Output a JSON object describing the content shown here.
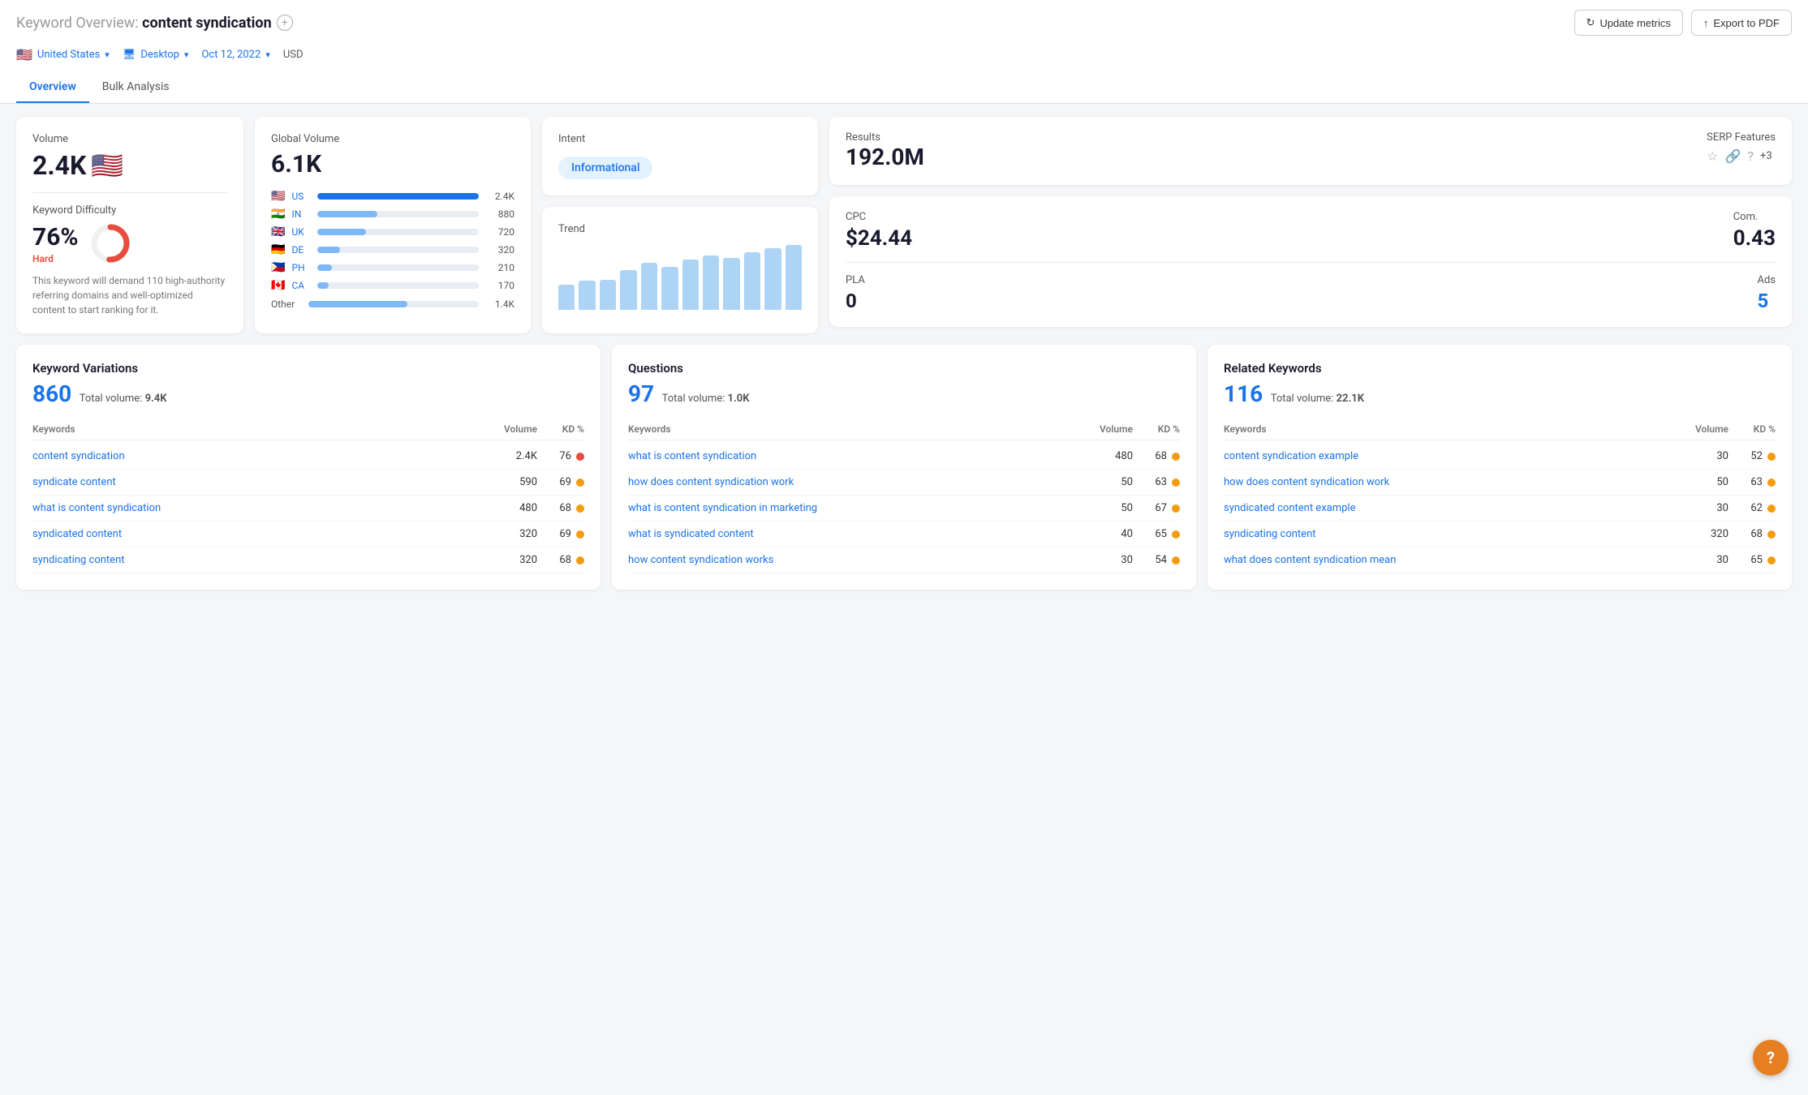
{
  "header": {
    "title": "Keyword Overview:",
    "keyword": "content syndication",
    "plus_btn": "+",
    "update_metrics_btn": "Update metrics",
    "export_pdf_btn": "Export to PDF"
  },
  "filters": {
    "country": "United States",
    "country_flag": "🇺🇸",
    "device": "Desktop",
    "device_icon": "🖥",
    "date": "Oct 12, 2022",
    "currency": "USD"
  },
  "tabs": [
    {
      "label": "Overview",
      "active": true
    },
    {
      "label": "Bulk Analysis",
      "active": false
    }
  ],
  "volume_card": {
    "label": "Volume",
    "value": "2.4K",
    "flag": "🇺🇸",
    "kd_label": "Keyword Difficulty",
    "kd_value": "76%",
    "kd_hard": "Hard",
    "kd_desc": "This keyword will demand 110 high-authority referring domains and well-optimized content to start ranking for it.",
    "donut_pct": 76,
    "donut_color": "#e74c3c",
    "donut_bg": "#f0f0f0"
  },
  "global_volume_card": {
    "label": "Global Volume",
    "value": "6.1K",
    "countries": [
      {
        "flag": "🇺🇸",
        "code": "US",
        "value": "2,400",
        "label": "2.4K",
        "pct": 100
      },
      {
        "flag": "🇮🇳",
        "code": "IN",
        "value": "880",
        "label": "880",
        "pct": 37
      },
      {
        "flag": "🇬🇧",
        "code": "UK",
        "value": "720",
        "label": "720",
        "pct": 30
      },
      {
        "flag": "🇩🇪",
        "code": "DE",
        "value": "320",
        "label": "320",
        "pct": 14
      },
      {
        "flag": "🇵🇭",
        "code": "PH",
        "value": "210",
        "label": "210",
        "pct": 9
      },
      {
        "flag": "🇨🇦",
        "code": "CA",
        "value": "170",
        "label": "170",
        "pct": 7
      }
    ],
    "other_label": "Other",
    "other_value": "1.4K",
    "other_pct": 58
  },
  "intent_card": {
    "label": "Intent",
    "badge": "Informational"
  },
  "trend_card": {
    "label": "Trend",
    "bars": [
      35,
      40,
      42,
      55,
      65,
      60,
      70,
      75,
      72,
      80,
      85,
      90
    ]
  },
  "results_card": {
    "results_label": "Results",
    "results_value": "192.0M",
    "serp_label": "SERP Features",
    "serp_icons": [
      "☆",
      "🔗",
      "?"
    ],
    "serp_plus": "+3"
  },
  "metrics_card": {
    "cpc_label": "CPC",
    "cpc_value": "$24.44",
    "com_label": "Com.",
    "com_value": "0.43",
    "pla_label": "PLA",
    "pla_value": "0",
    "ads_label": "Ads",
    "ads_value": "5"
  },
  "keyword_variations": {
    "section_title": "Keyword Variations",
    "count": "860",
    "total_volume_label": "Total volume:",
    "total_volume": "9.4K",
    "col_keywords": "Keywords",
    "col_volume": "Volume",
    "col_kd": "KD %",
    "rows": [
      {
        "keyword": "content syndication",
        "volume": "2.4K",
        "kd": 76,
        "dot": "red"
      },
      {
        "keyword": "syndicate content",
        "volume": "590",
        "kd": 69,
        "dot": "orange"
      },
      {
        "keyword": "what is content syndication",
        "volume": "480",
        "kd": 68,
        "dot": "orange"
      },
      {
        "keyword": "syndicated content",
        "volume": "320",
        "kd": 69,
        "dot": "orange"
      },
      {
        "keyword": "syndicating content",
        "volume": "320",
        "kd": 68,
        "dot": "orange"
      }
    ]
  },
  "questions": {
    "section_title": "Questions",
    "count": "97",
    "total_volume_label": "Total volume:",
    "total_volume": "1.0K",
    "col_keywords": "Keywords",
    "col_volume": "Volume",
    "col_kd": "KD %",
    "rows": [
      {
        "keyword": "what is content syndication",
        "volume": "480",
        "kd": 68,
        "dot": "orange"
      },
      {
        "keyword": "how does content syndication work",
        "volume": "50",
        "kd": 63,
        "dot": "orange"
      },
      {
        "keyword": "what is content syndication in marketing",
        "volume": "50",
        "kd": 67,
        "dot": "orange"
      },
      {
        "keyword": "what is syndicated content",
        "volume": "40",
        "kd": 65,
        "dot": "orange"
      },
      {
        "keyword": "how content syndication works",
        "volume": "30",
        "kd": 54,
        "dot": "orange"
      }
    ]
  },
  "related_keywords": {
    "section_title": "Related Keywords",
    "count": "116",
    "total_volume_label": "Total volume:",
    "total_volume": "22.1K",
    "col_keywords": "Keywords",
    "col_volume": "Volume",
    "col_kd": "KD %",
    "rows": [
      {
        "keyword": "content syndication example",
        "volume": "30",
        "kd": 52,
        "dot": "orange"
      },
      {
        "keyword": "how does content syndication work",
        "volume": "50",
        "kd": 63,
        "dot": "orange"
      },
      {
        "keyword": "syndicated content example",
        "volume": "30",
        "kd": 62,
        "dot": "orange"
      },
      {
        "keyword": "syndicating content",
        "volume": "320",
        "kd": 68,
        "dot": "orange"
      },
      {
        "keyword": "what does content syndication mean",
        "volume": "30",
        "kd": 65,
        "dot": "orange"
      }
    ]
  },
  "help_btn": "?"
}
